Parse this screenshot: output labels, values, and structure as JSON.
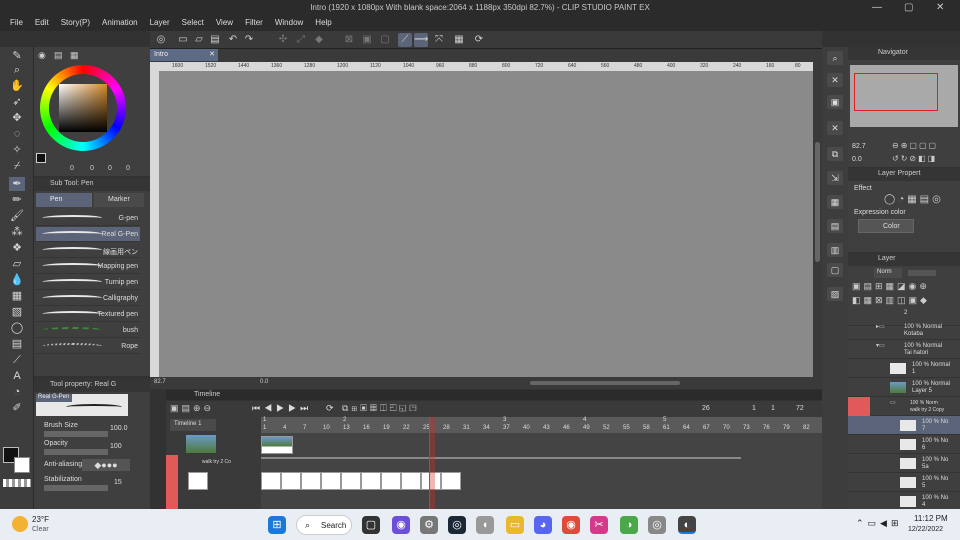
{
  "title_bar": {
    "title": "Intro (1920 x 1080px With blank space:2064 x 1188px 350dpi 82.7%) - CLIP STUDIO PAINT EX"
  },
  "menu": [
    "File",
    "Edit",
    "Story(P)",
    "Animation",
    "Layer",
    "Select",
    "View",
    "Filter",
    "Window",
    "Help"
  ],
  "canvas": {
    "tab_label": "Intro",
    "ruler_ticks": [
      "1600",
      "1520",
      "1440",
      "1360",
      "1280",
      "1200",
      "1120",
      "1040",
      "960",
      "880",
      "800",
      "720",
      "640",
      "560",
      "480",
      "400",
      "320",
      "240",
      "160",
      "80"
    ],
    "zoom": "82.7",
    "rotation": "0.0"
  },
  "sub_tool": {
    "header": "Sub Tool: Pen",
    "tabs": [
      "Pen",
      "Marker"
    ],
    "brushes": [
      "G-pen",
      "Real G-Pen",
      "線画用ペン",
      "Mapping pen",
      "Turnip pen",
      "Calligraphy",
      "Textured pen",
      "bush",
      "Rope"
    ],
    "selected_index": 1
  },
  "color": {
    "main": "#1a1a1a",
    "sub": "#ffffff",
    "values": [
      "0",
      "0",
      "0",
      "0"
    ]
  },
  "tool_property": {
    "header": "Tool property: Real G",
    "preview_label": "Real G-Pen",
    "brush_size_label": "Brush Size",
    "brush_size": "100.0",
    "opacity_label": "Opacity",
    "opacity": "100",
    "anti_alias_label": "Anti-aliasing",
    "stabilization_label": "Stabilization",
    "stabilization": "15"
  },
  "navigator": {
    "header": "Navigator",
    "zoom": "82.7",
    "rotation": "0.0"
  },
  "layer_property": {
    "header": "Layer Propert",
    "effect_label": "Effect",
    "expression_label": "Expression color",
    "expression_value": "Color"
  },
  "layers": {
    "header": "Layer",
    "blend": "Norm",
    "rows": [
      {
        "line1": "2",
        "line2": ""
      },
      {
        "line1": "100 % Normal",
        "line2": "Kotaba"
      },
      {
        "line1": "100 % Normal",
        "line2": "Tai hatori"
      },
      {
        "line1": "100 % Normal",
        "line2": "1"
      },
      {
        "line1": "100 % Normal",
        "line2": "Layer 5"
      },
      {
        "line1": "100 % Norm",
        "line2": "walk try 2 Copy"
      },
      {
        "line1": "100 % No",
        "line2": "7"
      },
      {
        "line1": "100 % No",
        "line2": "6"
      },
      {
        "line1": "100 % No",
        "line2": "5a"
      },
      {
        "line1": "100 % No",
        "line2": "5"
      },
      {
        "line1": "100 % No",
        "line2": "4"
      }
    ]
  },
  "timeline": {
    "header": "Timeline",
    "name": "Timeline 1",
    "current_frame": "26",
    "start_frame": "1",
    "fps": "1",
    "end_frame": "72",
    "track_label": "walk try 2 Co",
    "frame_numbers": [
      "1",
      "4",
      "7",
      "10",
      "13",
      "16",
      "19",
      "22",
      "25",
      "28",
      "31",
      "34",
      "37",
      "40",
      "43",
      "46",
      "49",
      "52",
      "55",
      "58",
      "61",
      "64",
      "67",
      "70",
      "73",
      "76",
      "79",
      "82"
    ],
    "section_marks": [
      "1",
      "2",
      "3",
      "4",
      "5"
    ]
  },
  "taskbar": {
    "weather_temp": "23°F",
    "weather_desc": "Clear",
    "search_label": "Search",
    "time": "11:12 PM",
    "date": "12/22/2022"
  }
}
